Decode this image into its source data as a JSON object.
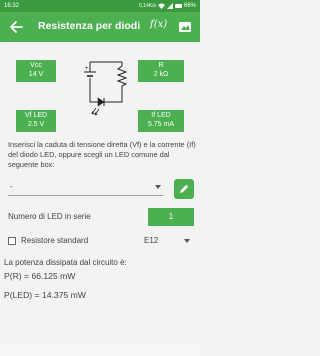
{
  "status_bar": {
    "time": "16:32",
    "network_speed": "0,14K/s",
    "battery_percent": "66%"
  },
  "app_bar": {
    "title": "Resistenza per diodi LED",
    "fx_label": "f(x)"
  },
  "circuit": {
    "vcc": {
      "label": "Vcc",
      "value": "14 V"
    },
    "resistor": {
      "label": "R",
      "value": "2 kΩ"
    },
    "vf_led": {
      "label": "Vf LED",
      "value": "2.5 V"
    },
    "if_led": {
      "label": "If LED",
      "value": "5.75 mA"
    },
    "battery_plus": "+"
  },
  "instructions": "Inserisci la caduta di tensione diretta (Vf) e la corrente (If) del diodo LED, oppure scegli un LED comune dal seguente box:",
  "led_selector": {
    "value": "-"
  },
  "led_count": {
    "label": "Numero di LED in serie",
    "value": "1"
  },
  "standard_resistor": {
    "label": "Resistore standard",
    "checked": false,
    "series": "E12"
  },
  "power": {
    "label": "La potenza dissipata dal circuito è:",
    "pr": "P(R) = 66.125 mW",
    "pled": "P(LED) = 14.375 mW"
  },
  "colors": {
    "primary": "#4caf50",
    "primary_dark": "#3a9a3e"
  }
}
